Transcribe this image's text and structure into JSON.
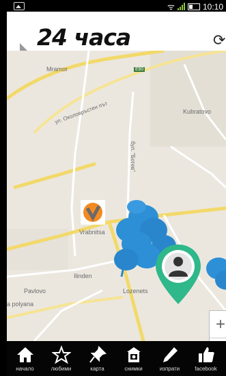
{
  "status_bar": {
    "time": "10:10"
  },
  "header": {
    "logo_text": "24 часа"
  },
  "map": {
    "labels": [
      "Mramor",
      "ул. Околовръстен път",
      "Kubratovo",
      "бул. \"Ботев\"",
      "Vrabnitsa",
      "Ilinden",
      "a polyana",
      "Lozenets",
      "Pavlovo",
      "E80"
    ]
  },
  "zoom": {
    "in": "+",
    "out": "−"
  },
  "nav": {
    "items": [
      {
        "label": "начало",
        "icon": "home-icon"
      },
      {
        "label": "любими",
        "icon": "star-icon"
      },
      {
        "label": "карта",
        "icon": "pin-icon"
      },
      {
        "label": "снимки",
        "icon": "camera-icon"
      },
      {
        "label": "изпрати",
        "icon": "pencil-icon"
      },
      {
        "label": "facebook",
        "icon": "like-icon"
      }
    ]
  },
  "colors": {
    "marker_blue": "#2d8fd6",
    "marker_green": "#2fb88a",
    "nav_bg": "#050505"
  }
}
